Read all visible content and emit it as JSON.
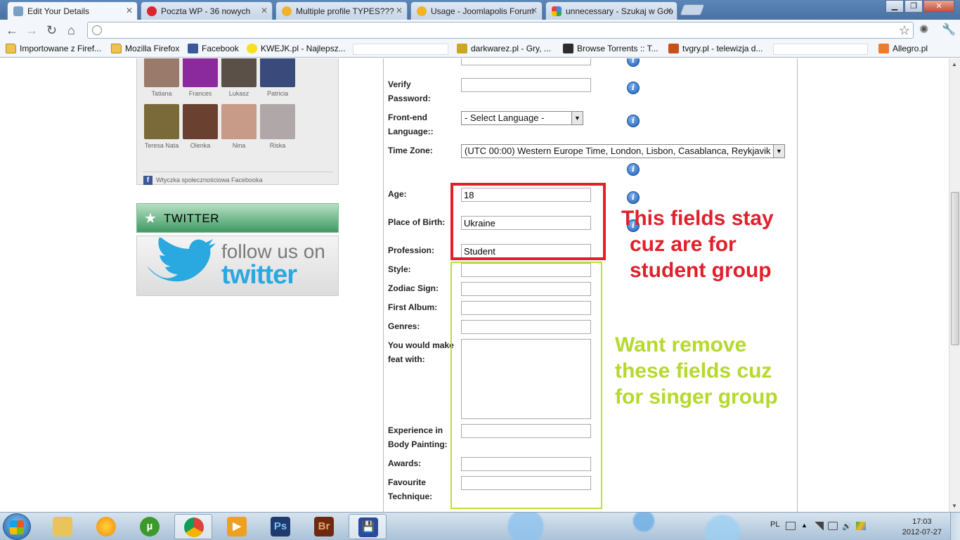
{
  "browser": {
    "tabs": [
      {
        "title": "Edit Your Details",
        "color": "#7aa0c8"
      },
      {
        "title": "Poczta WP - 36 nowych",
        "color": "#d9262c"
      },
      {
        "title": "Multiple profile TYPES???",
        "color": "#f0b429"
      },
      {
        "title": "Usage - Joomlapolis Forum",
        "color": "#f0b429"
      },
      {
        "title": "unnecessary - Szukaj w Goo",
        "color": "#4285f4"
      }
    ],
    "address_value": "",
    "bookmarks": [
      {
        "label": "Importowane z Firef...",
        "icon": "folder-icon"
      },
      {
        "label": "Mozilla Firefox",
        "icon": "folder-icon"
      },
      {
        "label": "Facebook",
        "icon": "facebook-icon"
      },
      {
        "label": "KWEJK.pl - Najlepsz...",
        "icon": "smiley-icon"
      },
      {
        "label": "darkwarez.pl - Gry, ...",
        "icon": "darkwarez-icon"
      },
      {
        "label": "Browse Torrents :: T...",
        "icon": "torrent-icon"
      },
      {
        "label": "tvgry.pl - telewizja d...",
        "icon": "tvgry-icon"
      },
      {
        "label": "Allegro.pl",
        "icon": "allegro-icon"
      }
    ]
  },
  "sidebar": {
    "friends": [
      {
        "name": "Tatiana",
        "color": "#9a7a6a"
      },
      {
        "name": "Frances",
        "color": "#8a2a9c"
      },
      {
        "name": "Lukasz",
        "color": "#5a5048"
      },
      {
        "name": "Patricia",
        "color": "#3a4a7a"
      },
      {
        "name": "Teresa Nata",
        "color": "#7a6a3a"
      },
      {
        "name": "Olenka",
        "color": "#6a4030"
      },
      {
        "name": "Nina",
        "color": "#c89a88"
      },
      {
        "name": "Riska",
        "color": "#b0a8a8"
      }
    ],
    "facebook_plugin": "Wtyczka społecznościowa Facebooka",
    "twitter_title": "TWITTER",
    "twitter_banner": {
      "line1": "follow us on",
      "line2": "twitter"
    }
  },
  "form": {
    "verify_password": {
      "label": "Verify Password:",
      "value": ""
    },
    "frontend_language": {
      "label": "Front-end Language::",
      "value": "- Select Language -"
    },
    "timezone": {
      "label": "Time Zone:",
      "value": "(UTC 00:00) Western Europe Time, London, Lisbon, Casablanca, Reykjavik"
    },
    "age": {
      "label": "Age:",
      "value": "18"
    },
    "place_of_birth": {
      "label": "Place of Birth:",
      "value": "Ukraine"
    },
    "profession": {
      "label": "Profession:",
      "value": "Student"
    },
    "style": {
      "label": "Style:",
      "value": ""
    },
    "zodiac_sign": {
      "label": "Zodiac Sign:",
      "value": ""
    },
    "first_album": {
      "label": "First Album:",
      "value": ""
    },
    "genres": {
      "label": "Genres:",
      "value": ""
    },
    "feat_with": {
      "label": "You would make feat with:",
      "value": ""
    },
    "body_painting": {
      "label": "Experience in Body Painting:",
      "value": ""
    },
    "awards": {
      "label": "Awards:",
      "value": ""
    },
    "favourite_technique": {
      "label": "Favourite Technique:",
      "value": ""
    }
  },
  "annotations": {
    "red": {
      "lines": [
        "This fields stay",
        "cuz are for",
        "student group"
      ],
      "color": "#e0202c"
    },
    "green": {
      "lines": [
        "Want remove",
        "these fields cuz",
        "for singer group"
      ],
      "color": "#b5d92d"
    }
  },
  "taskbar": {
    "apps": [
      "explorer",
      "weather",
      "utorrent",
      "chrome",
      "media-player",
      "photoshop",
      "bridge",
      "save"
    ],
    "language": "PL",
    "time": "17:03",
    "date": "2012-07-27"
  }
}
